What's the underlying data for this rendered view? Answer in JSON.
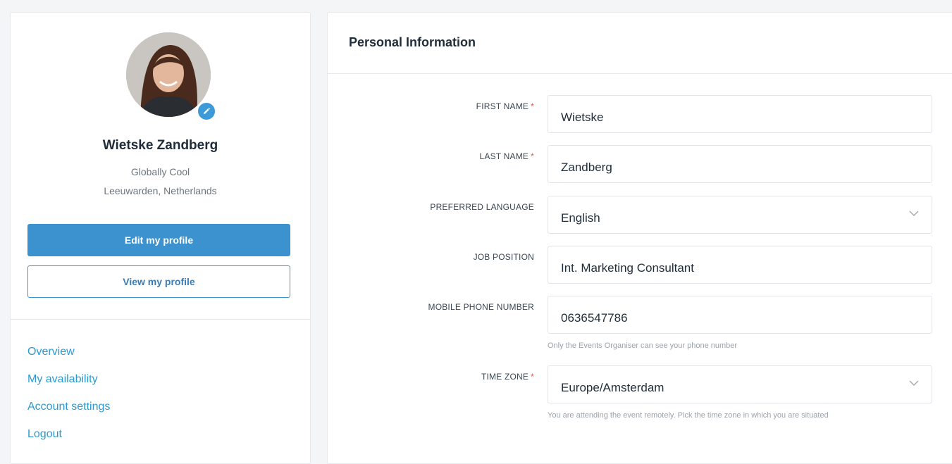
{
  "profile": {
    "name": "Wietske Zandberg",
    "company": "Globally Cool",
    "location": "Leeuwarden, Netherlands",
    "edit_button": "Edit my profile",
    "view_button": "View my profile"
  },
  "nav": {
    "items": [
      {
        "label": "Overview"
      },
      {
        "label": "My availability"
      },
      {
        "label": "Account settings"
      },
      {
        "label": "Logout"
      }
    ]
  },
  "form": {
    "title": "Personal Information",
    "required_mark": "*",
    "first_name": {
      "label": "FIRST NAME",
      "value": "Wietske"
    },
    "last_name": {
      "label": "LAST NAME",
      "value": "Zandberg"
    },
    "language": {
      "label": "PREFERRED LANGUAGE",
      "value": "English"
    },
    "job": {
      "label": "JOB POSITION",
      "value": "Int. Marketing Consultant"
    },
    "phone": {
      "label": "MOBILE PHONE NUMBER",
      "value": "0636547786",
      "help": "Only the Events Organiser can see your phone number"
    },
    "timezone": {
      "label": "TIME ZONE",
      "value": "Europe/Amsterdam",
      "help": "You are attending the event remotely. Pick the time zone in which you are situated"
    }
  },
  "colors": {
    "accent": "#3b92cf",
    "link": "#2c9ad1",
    "required": "#e05555"
  }
}
